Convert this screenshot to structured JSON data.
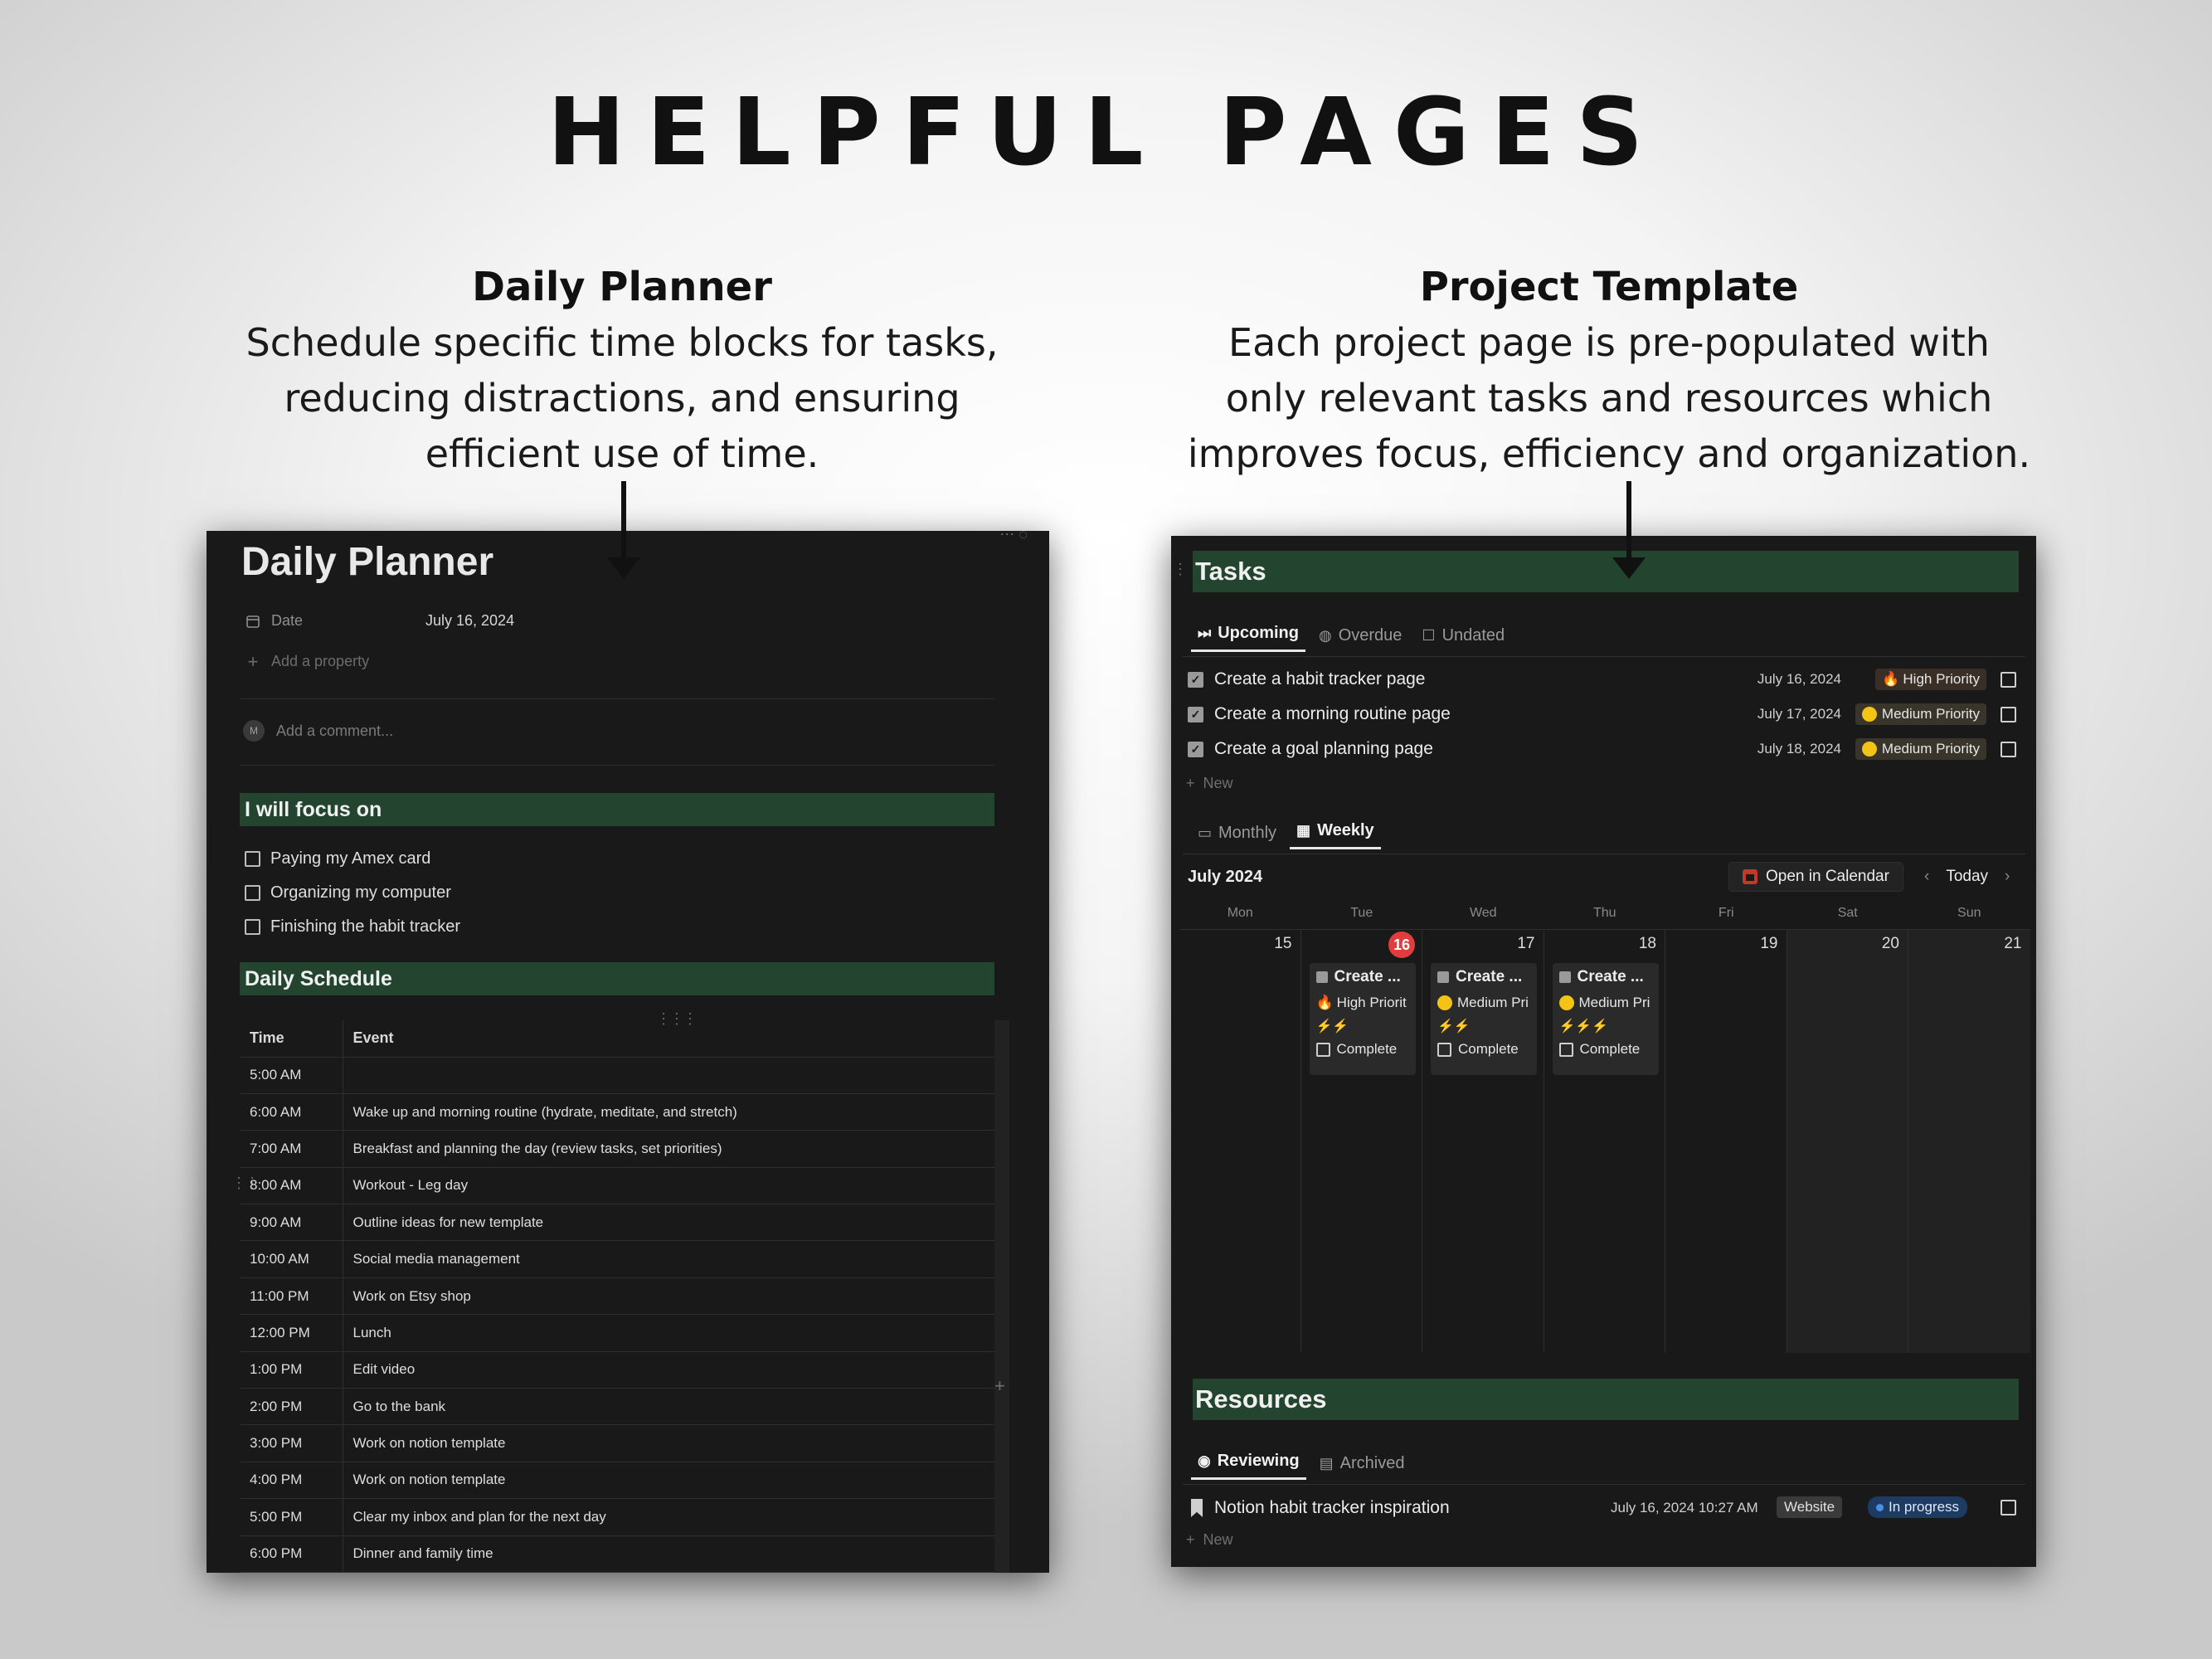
{
  "hero": {
    "title": "HELPFUL PAGES"
  },
  "daily_planner_intro": {
    "heading": "Daily Planner",
    "line1": "Schedule specific time blocks for tasks,",
    "line2": "reducing distractions, and ensuring",
    "line3": "efficient use of time."
  },
  "project_intro": {
    "heading": "Project Template",
    "line1": "Each project page is pre-populated with",
    "line2": "only relevant tasks and resources which",
    "line3": "improves focus, efficiency and organization."
  },
  "daily_planner": {
    "title": "Daily Planner",
    "date_label": "Date",
    "date_value": "July 16, 2024",
    "add_property": "Add a property",
    "avatar_initial": "M",
    "comment_placeholder": "Add a comment...",
    "focus_heading": "I will focus on",
    "focus_items": [
      "Paying my Amex card",
      "Organizing my computer",
      "Finishing the habit tracker"
    ],
    "schedule_heading": "Daily Schedule",
    "schedule_columns": {
      "time": "Time",
      "event": "Event"
    },
    "schedule": [
      {
        "time": "5:00 AM",
        "event": ""
      },
      {
        "time": "6:00 AM",
        "event": "Wake up and morning routine (hydrate, meditate, and stretch)"
      },
      {
        "time": "7:00 AM",
        "event": "Breakfast and planning the day (review tasks, set priorities)"
      },
      {
        "time": "8:00 AM",
        "event": "Workout - Leg day"
      },
      {
        "time": "9:00 AM",
        "event": "Outline ideas for new template"
      },
      {
        "time": "10:00 AM",
        "event": "Social media management"
      },
      {
        "time": "11:00 PM",
        "event": "Work on Etsy shop"
      },
      {
        "time": "12:00 PM",
        "event": "Lunch"
      },
      {
        "time": "1:00 PM",
        "event": "Edit video"
      },
      {
        "time": "2:00 PM",
        "event": "Go to the bank"
      },
      {
        "time": "3:00 PM",
        "event": "Work on notion template"
      },
      {
        "time": "4:00 PM",
        "event": "Work on notion template"
      },
      {
        "time": "5:00 PM",
        "event": "Clear my inbox and plan for the next day"
      },
      {
        "time": "6:00 PM",
        "event": "Dinner and family time"
      }
    ]
  },
  "project": {
    "tasks_heading": "Tasks",
    "task_tabs": {
      "upcoming": "Upcoming",
      "overdue": "Overdue",
      "undated": "Undated"
    },
    "tasks": [
      {
        "name": "Create a habit tracker page",
        "date": "July 16, 2024",
        "priority": "High Priority"
      },
      {
        "name": "Create a morning routine page",
        "date": "July 17, 2024",
        "priority": "Medium Priority"
      },
      {
        "name": "Create a goal planning page",
        "date": "July 18, 2024",
        "priority": "Medium Priority"
      }
    ],
    "new_label": "New",
    "view_tabs": {
      "monthly": "Monthly",
      "weekly": "Weekly"
    },
    "month_label": "July 2024",
    "open_in_calendar": "Open in Calendar",
    "today_label": "Today",
    "weekdays": [
      "Mon",
      "Tue",
      "Wed",
      "Thu",
      "Fri",
      "Sat",
      "Sun"
    ],
    "days": [
      "15",
      "16",
      "17",
      "18",
      "19",
      "20",
      "21"
    ],
    "cards": [
      {
        "title": "Create ...",
        "priority": "High Priorit",
        "bolts": "⚡⚡",
        "complete": "Complete"
      },
      {
        "title": "Create ...",
        "priority": "Medium Pri",
        "bolts": "⚡⚡",
        "complete": "Complete"
      },
      {
        "title": "Create ...",
        "priority": "Medium Pri",
        "bolts": "⚡⚡⚡",
        "complete": "Complete"
      }
    ],
    "resources_heading": "Resources",
    "resource_tabs": {
      "reviewing": "Reviewing",
      "archived": "Archived"
    },
    "resource": {
      "name": "Notion habit tracker inspiration",
      "date": "July 16, 2024 10:27 AM",
      "type": "Website",
      "status": "In progress"
    }
  }
}
